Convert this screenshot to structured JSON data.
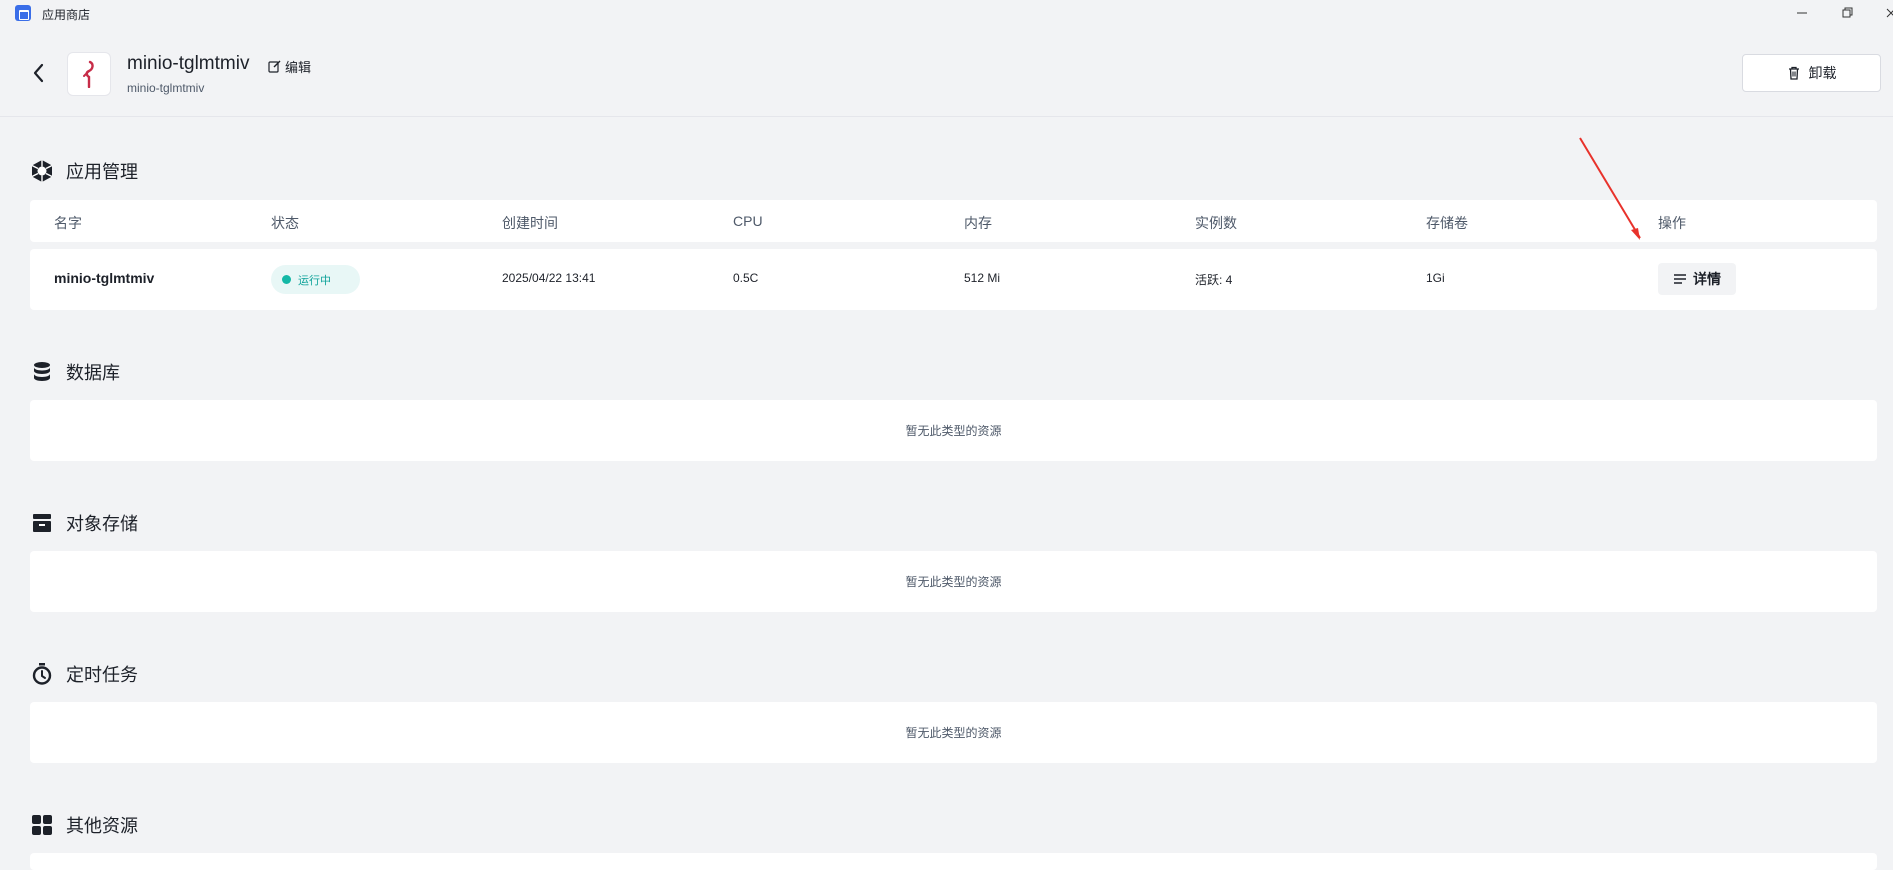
{
  "window": {
    "title": "应用商店"
  },
  "header": {
    "app_name": "minio-tglmtmiv",
    "app_subtitle": "minio-tglmtmiv",
    "edit_label": "编辑",
    "uninstall_label": "卸载"
  },
  "sections": {
    "app_management": "应用管理",
    "database": "数据库",
    "object_storage": "对象存储",
    "cron_jobs": "定时任务",
    "other_resources": "其他资源"
  },
  "table": {
    "columns": [
      "名字",
      "状态",
      "创建时间",
      "CPU",
      "内存",
      "实例数",
      "存储卷",
      "操作"
    ],
    "row": {
      "name": "minio-tglmtmiv",
      "status": "运行中",
      "created": "2025/04/22 13:41",
      "cpu": "0.5C",
      "memory": "512 Mi",
      "instances": "活跃: 4",
      "volume": "1Gi",
      "action": "详情"
    }
  },
  "empty_text": "暂无此类型的资源",
  "colors": {
    "status_running": "#14b8a6",
    "annotation": "#e8322b",
    "logo_accent": "#c72c48"
  }
}
